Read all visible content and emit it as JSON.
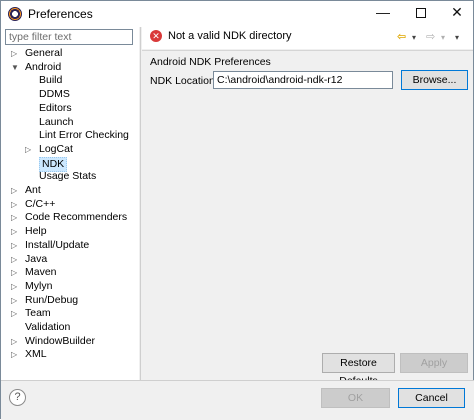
{
  "window": {
    "title": "Preferences",
    "controls": {
      "minimize": "—",
      "close": "✕"
    }
  },
  "filter": {
    "placeholder": "type filter text",
    "value": ""
  },
  "tree": {
    "items": [
      {
        "label": "General",
        "expanded": false,
        "has_children": true,
        "level": 0
      },
      {
        "label": "Android",
        "expanded": true,
        "has_children": true,
        "level": 0
      },
      {
        "label": "Build",
        "level": 1
      },
      {
        "label": "DDMS",
        "level": 1
      },
      {
        "label": "Editors",
        "level": 1
      },
      {
        "label": "Launch",
        "level": 1
      },
      {
        "label": "Lint Error Checking",
        "level": 1
      },
      {
        "label": "LogCat",
        "expanded": false,
        "has_children": true,
        "level": 1
      },
      {
        "label": "NDK",
        "level": 1,
        "selected": true
      },
      {
        "label": "Usage Stats",
        "level": 1
      },
      {
        "label": "Ant",
        "expanded": false,
        "has_children": true,
        "level": 0
      },
      {
        "label": "C/C++",
        "expanded": false,
        "has_children": true,
        "level": 0
      },
      {
        "label": "Code Recommenders",
        "expanded": false,
        "has_children": true,
        "level": 0
      },
      {
        "label": "Help",
        "expanded": false,
        "has_children": true,
        "level": 0
      },
      {
        "label": "Install/Update",
        "expanded": false,
        "has_children": true,
        "level": 0
      },
      {
        "label": "Java",
        "expanded": false,
        "has_children": true,
        "level": 0
      },
      {
        "label": "Maven",
        "expanded": false,
        "has_children": true,
        "level": 0
      },
      {
        "label": "Mylyn",
        "expanded": false,
        "has_children": true,
        "level": 0
      },
      {
        "label": "Run/Debug",
        "expanded": false,
        "has_children": true,
        "level": 0
      },
      {
        "label": "Team",
        "expanded": false,
        "has_children": true,
        "level": 0
      },
      {
        "label": "Validation",
        "level": 0
      },
      {
        "label": "WindowBuilder",
        "expanded": false,
        "has_children": true,
        "level": 0
      },
      {
        "label": "XML",
        "expanded": false,
        "has_children": true,
        "level": 0
      }
    ]
  },
  "message": {
    "text": "Not a valid NDK directory",
    "type": "error"
  },
  "nav": {
    "back": "⇦",
    "forward": "⇨",
    "dropdown": "▾"
  },
  "page": {
    "section_title": "Android NDK Preferences",
    "ndk_location_label": "NDK Location",
    "ndk_location_value": "C:\\android\\android-ndk-r12",
    "browse_label": "Browse...",
    "restore_defaults_label": "Restore Defaults",
    "apply_label": "Apply"
  },
  "footer": {
    "help": "?",
    "ok_label": "OK",
    "cancel_label": "Cancel"
  },
  "colors": {
    "selection": "#cce8ff",
    "error": "#d93a3a",
    "focus_border": "#0078d7"
  }
}
